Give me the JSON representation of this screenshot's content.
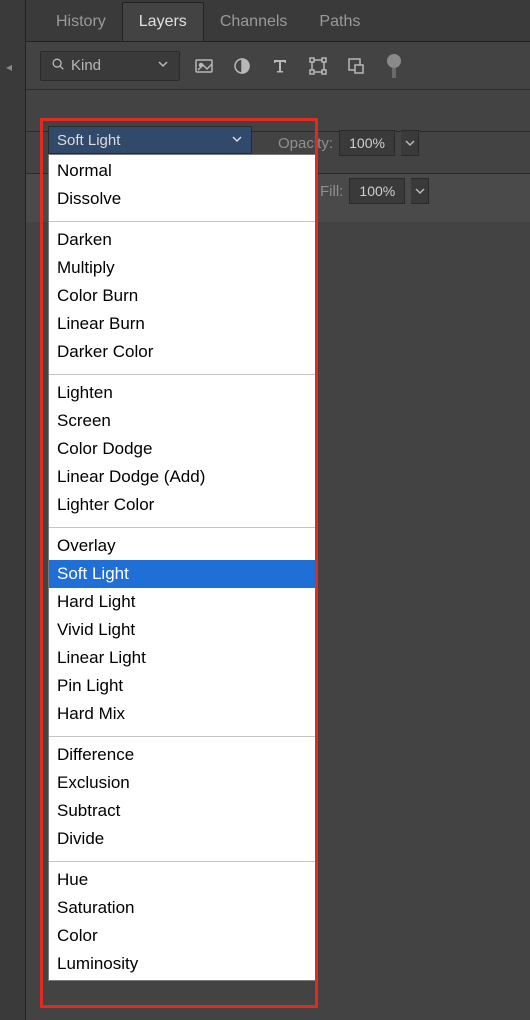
{
  "tabs": {
    "history": "History",
    "layers": "Layers",
    "channels": "Channels",
    "paths": "Paths"
  },
  "filter": {
    "kind_label": "Kind"
  },
  "blend": {
    "selected": "Soft Light",
    "opacity_label": "Opacity:",
    "opacity_value": "100%",
    "fill_label": "Fill:",
    "fill_value": "100%",
    "groups": [
      {
        "items": [
          "Normal",
          "Dissolve"
        ]
      },
      {
        "items": [
          "Darken",
          "Multiply",
          "Color Burn",
          "Linear Burn",
          "Darker Color"
        ]
      },
      {
        "items": [
          "Lighten",
          "Screen",
          "Color Dodge",
          "Linear Dodge (Add)",
          "Lighter Color"
        ]
      },
      {
        "items": [
          "Overlay",
          "Soft Light",
          "Hard Light",
          "Vivid Light",
          "Linear Light",
          "Pin Light",
          "Hard Mix"
        ]
      },
      {
        "items": [
          "Difference",
          "Exclusion",
          "Subtract",
          "Divide"
        ]
      },
      {
        "items": [
          "Hue",
          "Saturation",
          "Color",
          "Luminosity"
        ]
      }
    ]
  }
}
